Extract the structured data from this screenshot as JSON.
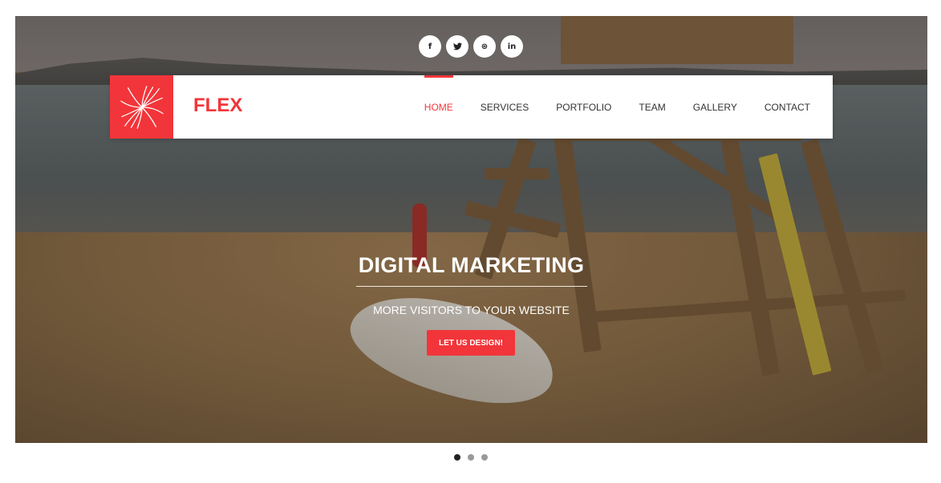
{
  "social": [
    {
      "icon": "facebook-icon",
      "glyph": "f"
    },
    {
      "icon": "twitter-icon",
      "glyph": "🐦"
    },
    {
      "icon": "dribbble-icon",
      "glyph": "⊛"
    },
    {
      "icon": "linkedin-icon",
      "glyph": "in"
    }
  ],
  "brand": {
    "name": "FLEX",
    "color": "#f2353a"
  },
  "nav": {
    "items": [
      "HOME",
      "SERVICES",
      "PORTFOLIO",
      "TEAM",
      "GALLERY",
      "CONTACT"
    ],
    "active": "HOME"
  },
  "hero": {
    "title": "DIGITAL MARKETING",
    "subtitle": "MORE VISITORS TO YOUR WEBSITE",
    "cta_label": "LET US DESIGN!"
  },
  "slider": {
    "slide_count": 3,
    "active_slide": 1
  }
}
